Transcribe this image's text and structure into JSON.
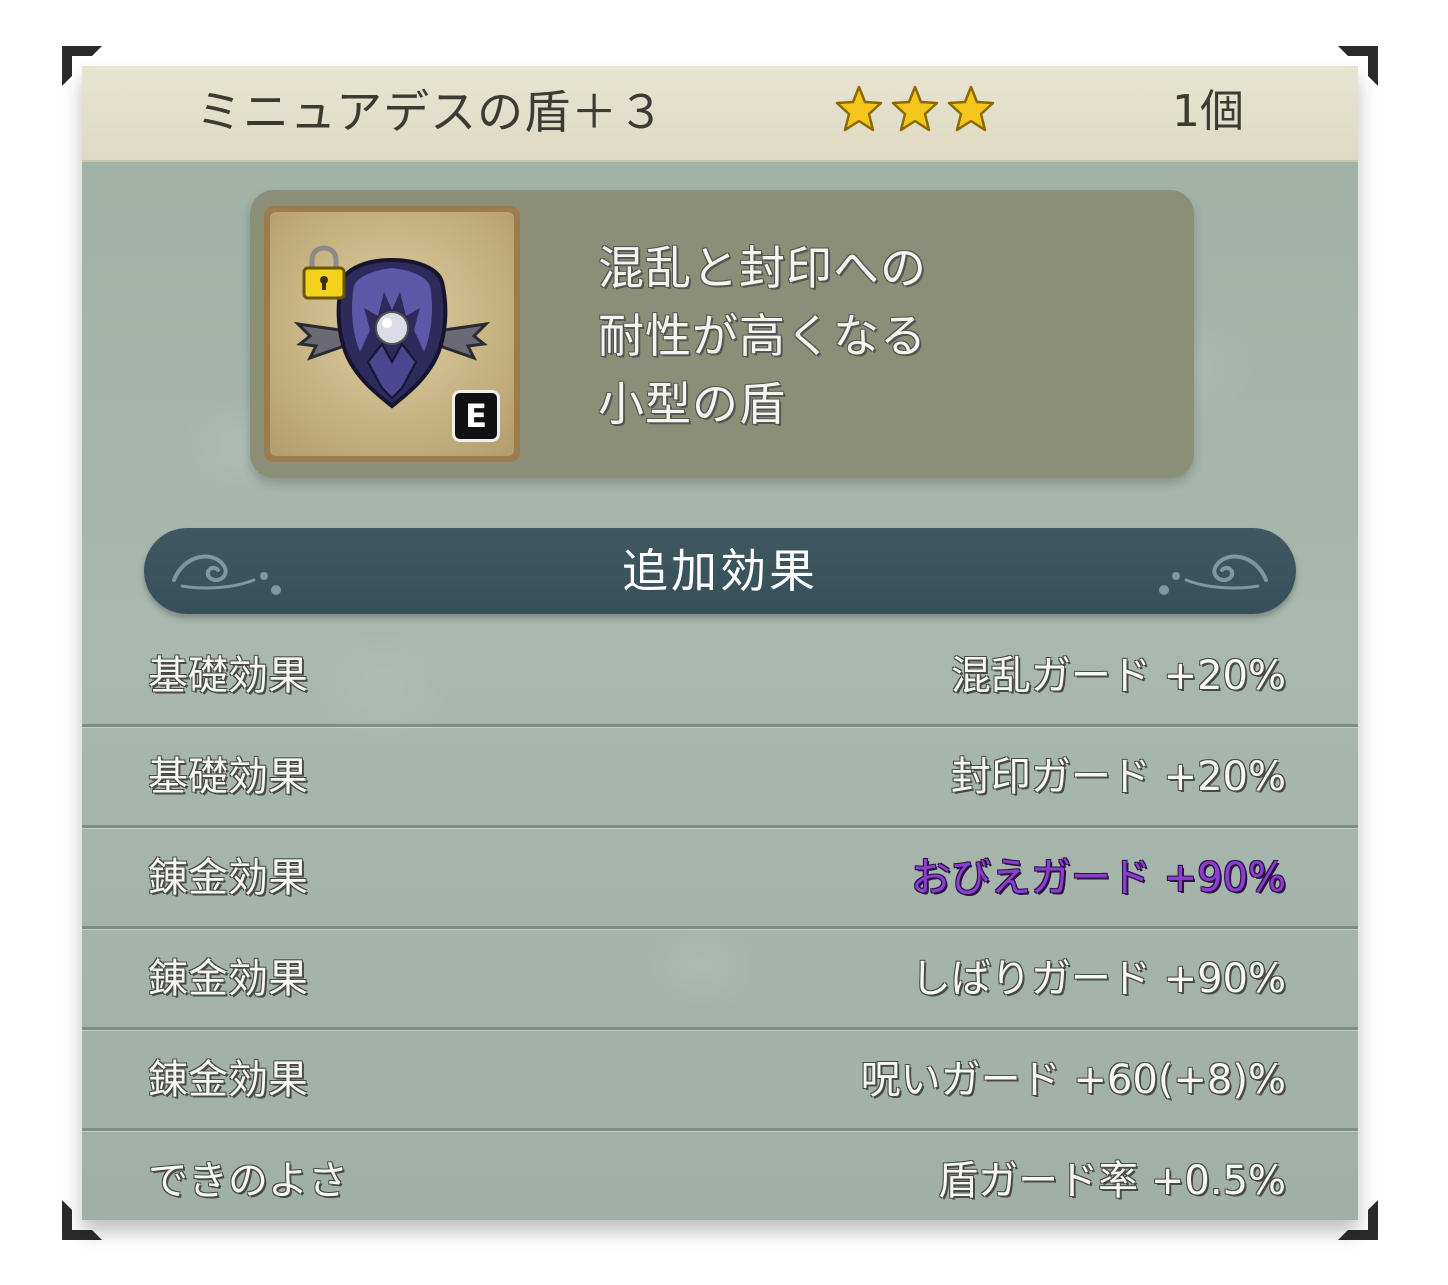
{
  "item": {
    "name": "ミニュアデスの盾＋３",
    "rarity_stars": 3,
    "count": "1個",
    "star_color": "#f5c61a",
    "equipped_badge": "E",
    "description_lines": [
      "混乱と封印への",
      "耐性が高くなる",
      "小型の盾"
    ],
    "icon": "small-demon-shield-icon",
    "locked": true
  },
  "effects": {
    "section_title": "追加効果",
    "highlight_color": "#8a3fd0",
    "rows": [
      {
        "label": "基礎効果",
        "value": "混乱ガード +20%",
        "highlight": false
      },
      {
        "label": "基礎効果",
        "value": "封印ガード +20%",
        "highlight": false
      },
      {
        "label": "錬金効果",
        "value": "おびえガード +90%",
        "highlight": true
      },
      {
        "label": "錬金効果",
        "value": "しばりガード +90%",
        "highlight": false
      },
      {
        "label": "錬金効果",
        "value": "呪いガード +60(+8)%",
        "highlight": false
      },
      {
        "label": "できのよさ",
        "value": "盾ガード率 +0.5%",
        "highlight": false
      }
    ]
  }
}
